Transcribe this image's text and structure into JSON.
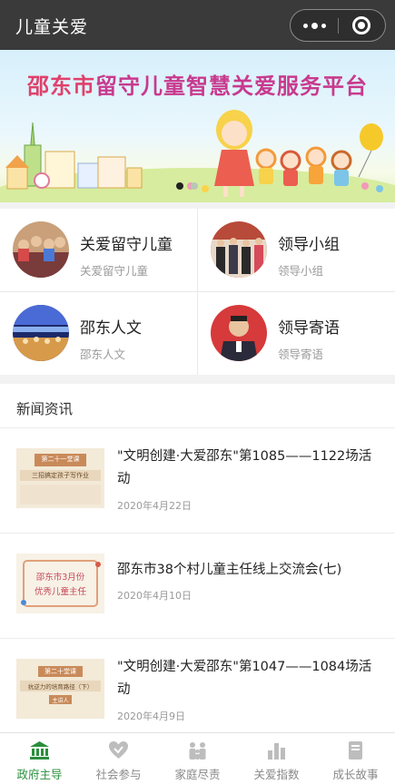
{
  "app": {
    "title": "儿童关爱"
  },
  "banner": {
    "title_part1": "邵东市",
    "title_part2": "留守儿童智慧关爱服务平台",
    "slide_count": 2,
    "active_slide": 1
  },
  "grid": [
    {
      "title": "关爱留守儿童",
      "subtitle": "关爱留守儿童"
    },
    {
      "title": "领导小组",
      "subtitle": "领导小组"
    },
    {
      "title": "邵东人文",
      "subtitle": "邵东人文"
    },
    {
      "title": "领导寄语",
      "subtitle": "领导寄语"
    }
  ],
  "news": {
    "heading": "新闻资讯",
    "items": [
      {
        "title": "\"文明创建·大爱邵东\"第1085——1122场活动",
        "date": "2020年4月22日",
        "thumb_line1": "第二十一堂课",
        "thumb_line2": "三招搞定孩子写作业"
      },
      {
        "title": "邵东市38个村儿童主任线上交流会(七)",
        "date": "2020年4月10日",
        "thumb_line1": "邵东市3月份",
        "thumb_line2": "优秀儿童主任"
      },
      {
        "title": "\"文明创建·大爱邵东\"第1047——1084场活动",
        "date": "2020年4月9日",
        "thumb_line1": "第二十堂课",
        "thumb_line2": "抗逆力的培育路径（下）",
        "thumb_line3": "主讲人"
      }
    ]
  },
  "tabbar": [
    {
      "label": "政府主导",
      "icon": "government-icon",
      "active": true
    },
    {
      "label": "社会参与",
      "icon": "heart-hands-icon",
      "active": false
    },
    {
      "label": "家庭尽责",
      "icon": "family-icon",
      "active": false
    },
    {
      "label": "关爱指数",
      "icon": "bar-chart-icon",
      "active": false
    },
    {
      "label": "成长故事",
      "icon": "book-icon",
      "active": false
    }
  ],
  "colors": {
    "accent": "#2a8f3d",
    "topbar": "#3a3a3a",
    "banner_title": "#e0406b"
  }
}
